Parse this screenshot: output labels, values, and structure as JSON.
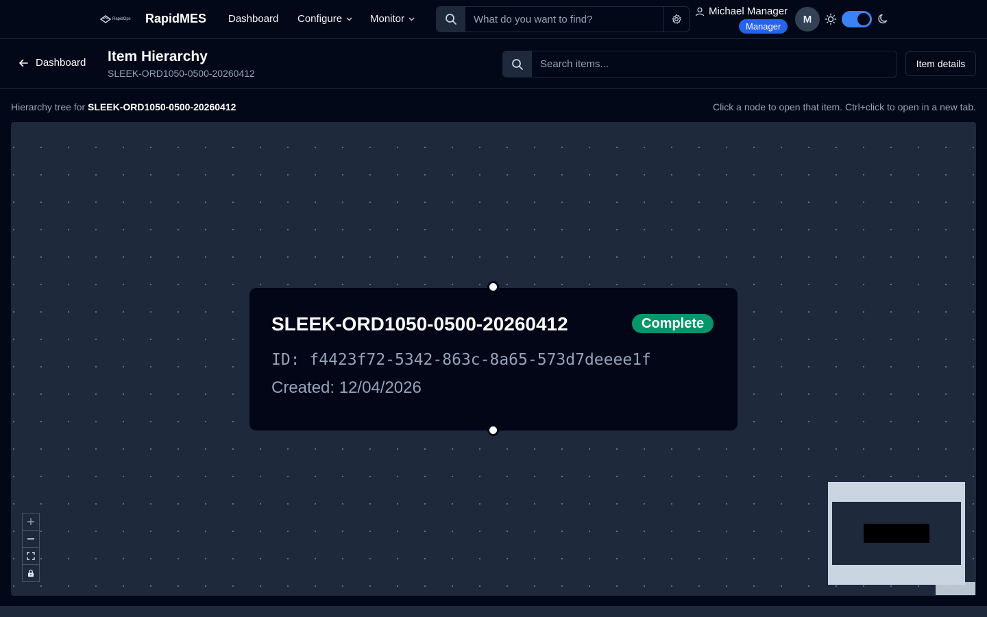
{
  "header": {
    "brand_logo_text": "RapidOps",
    "brand_name": "RapidMES",
    "nav": [
      {
        "label": "Dashboard"
      },
      {
        "label": "Configure"
      },
      {
        "label": "Monitor"
      }
    ],
    "search_placeholder": "What do you want to find?",
    "user_name": "Michael Manager",
    "user_role": "Manager",
    "avatar_initial": "M"
  },
  "subheader": {
    "back_label": "Dashboard",
    "title": "Item Hierarchy",
    "subtitle": "SLEEK-ORD1050-0500-20260412",
    "search_placeholder": "Search items...",
    "details_button": "Item details"
  },
  "info": {
    "prefix": "Hierarchy tree for ",
    "item": "SLEEK-ORD1050-0500-20260412",
    "hint": "Click a node to open that item. Ctrl+click to open in a new tab."
  },
  "node": {
    "title": "SLEEK-ORD1050-0500-20260412",
    "status": "Complete",
    "id_line": "ID: f4423f72-5342-863c-8a65-573d7deeee1f",
    "created_line": "Created: 12/04/2026"
  },
  "colors": {
    "background": "#020817",
    "canvas": "#1e293b",
    "accent": "#3b82f6",
    "status_complete": "#059669"
  },
  "icons": [
    "back-arrow-icon",
    "search-icon",
    "gear-icon",
    "user-icon",
    "sun-icon",
    "moon-icon",
    "plus-icon",
    "minus-icon",
    "fit-view-icon",
    "lock-icon",
    "chevron-down-icon"
  ]
}
